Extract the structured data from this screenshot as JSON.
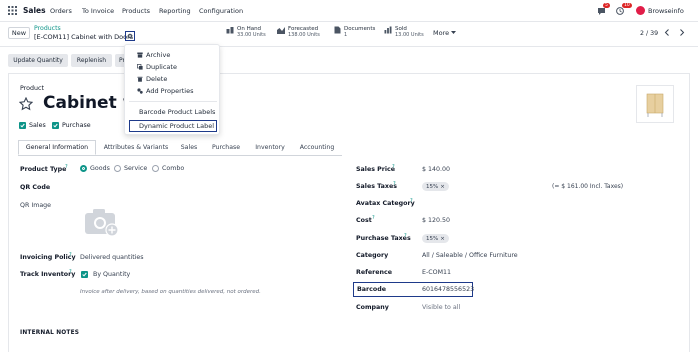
{
  "topnav": {
    "app_name": "Sales",
    "menu": [
      "Orders",
      "To Invoice",
      "Products",
      "Reporting",
      "Configuration"
    ],
    "activity_count": "5",
    "message_count": "10",
    "user": "Browseinfo"
  },
  "control": {
    "new_label": "New",
    "breadcrumb_parent": "Products",
    "breadcrumb_current": "[E-COM11] Cabinet with Doors",
    "pager": "2 / 39",
    "more_label": "More",
    "smart_buttons": [
      {
        "label": "On Hand",
        "sub": "33.00 Units"
      },
      {
        "label": "Forecasted",
        "sub": "138.00 Units"
      },
      {
        "label": "Documents",
        "sub": "1"
      },
      {
        "label": "Sold",
        "sub": "13.00 Units"
      }
    ]
  },
  "dropdown": {
    "items": [
      "Archive",
      "Duplicate",
      "Delete",
      "Add Properties",
      "Barcode Product Labels",
      "Dynamic Product Label"
    ]
  },
  "actions": [
    "Update Quantity",
    "Replenish",
    "Pri"
  ],
  "product": {
    "label": "Product",
    "name": "Cabinet wit",
    "sales_label": "Sales",
    "purchase_label": "Purchase"
  },
  "tabs": [
    "General Information",
    "Attributes & Variants",
    "Sales",
    "Purchase",
    "Inventory",
    "Accounting"
  ],
  "left": {
    "product_type_label": "Product Type",
    "product_type_options": [
      "Goods",
      "Service",
      "Combo"
    ],
    "qr_code_label": "QR Code",
    "qr_image_label": "QR Image",
    "invoicing_policy_label": "Invoicing Policy",
    "invoicing_policy_value": "Delivered quantities",
    "track_inventory_label": "Track Inventory",
    "track_inventory_value": "By Quantity",
    "note": "Invoice after delivery, based on quantities delivered, not ordered.",
    "internal_notes": "INTERNAL NOTES"
  },
  "right": {
    "sales_price_label": "Sales Price",
    "sales_price": "$ 140.00",
    "sales_taxes_label": "Sales Taxes",
    "sales_tax_badge": "15%",
    "incl_taxes": "(= $ 161.00 Incl. Taxes)",
    "avatax_label": "Avatax Category",
    "cost_label": "Cost",
    "cost": "$ 120.50",
    "purchase_taxes_label": "Purchase Taxes",
    "purchase_tax_badge": "15%",
    "category_label": "Category",
    "category": "All / Saleable / Office Furniture",
    "reference_label": "Reference",
    "reference": "E-COM11",
    "barcode_label": "Barcode",
    "barcode": "6016478556523",
    "company_label": "Company",
    "company": "Visible to all"
  },
  "colors": {
    "accent": "#714b67",
    "teal": "#0d9488",
    "highlight_box": "#1e3a8a",
    "badge_red": "#dc2626"
  }
}
